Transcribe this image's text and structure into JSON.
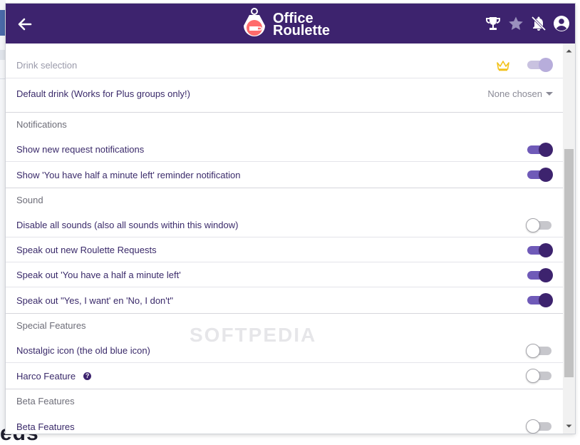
{
  "app": {
    "logo_line1": "Office",
    "logo_line2": "Roulette"
  },
  "background": {
    "bottom_text": "eds"
  },
  "settings": {
    "drink_selection": "Drink selection",
    "default_drink": "Default drink (Works for Plus groups only!)",
    "default_drink_value": "None chosen",
    "notifications_header": "Notifications",
    "show_new_request": "Show new request notifications",
    "show_half_minute": "Show 'You have half a minute left' reminder notification",
    "sound_header": "Sound",
    "disable_sounds": "Disable all sounds (also all sounds within this window)",
    "speak_new_requests": "Speak out new Roulette Requests",
    "speak_half_minute": "Speak out 'You have a half a minute left'",
    "speak_yes_no": "Speak out \"Yes, I want' en 'No, I don't\"",
    "special_header": "Special Features",
    "nostalgic_icon": "Nostalgic icon (the old blue icon)",
    "harco_feature": "Harco Feature",
    "harco_help": "?",
    "beta_header": "Beta Features",
    "beta_features": "Beta Features"
  },
  "toggles": {
    "drink_selection": "disabled",
    "show_new_request": "on",
    "show_half_minute": "on",
    "disable_sounds": "off",
    "speak_new_requests": "on",
    "speak_half_minute": "on",
    "speak_yes_no": "on",
    "nostalgic_icon": "off",
    "harco_feature": "off",
    "beta_features": "off"
  },
  "watermark": "SOFTPEDIA",
  "colors": {
    "header": "#3d236e",
    "toggle_on_knob": "#3d236e",
    "toggle_on_track": "#6f5ab8",
    "crown": "#f2c21b"
  },
  "icons": {
    "header_left": "back-arrow-icon",
    "header_right": [
      "trophy-icon",
      "star-icon",
      "bell-off-icon",
      "account-circle-icon"
    ]
  }
}
